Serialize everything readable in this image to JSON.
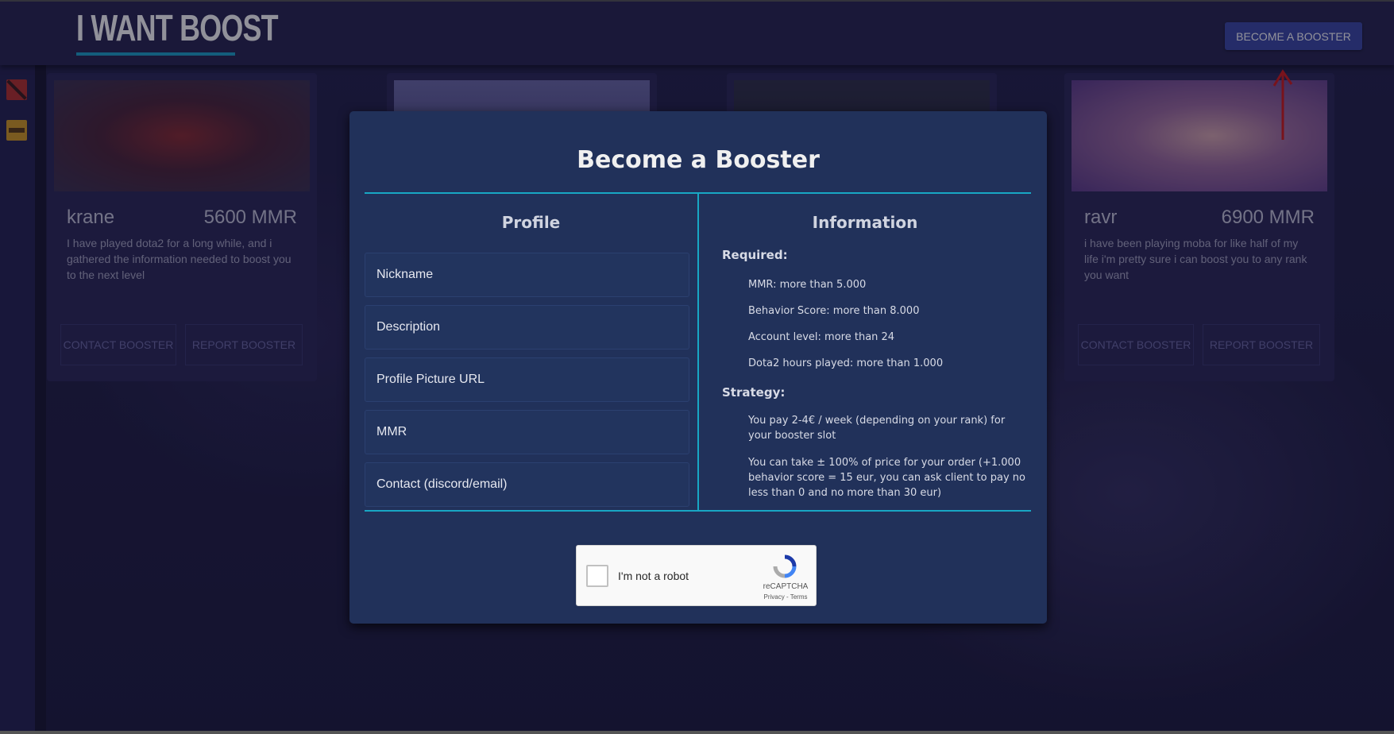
{
  "header": {
    "logo": "I WANT BOOST",
    "become_booster_label": "BECOME A BOOSTER"
  },
  "sidebar": {
    "items": [
      {
        "icon": "dota2-icon"
      },
      {
        "icon": "csgo-icon"
      }
    ]
  },
  "cards": [
    {
      "name": "krane",
      "mmr": "5600 MMR",
      "description": "I have played dota2 for a long while, and i gathered the information needed to boost you to the next level",
      "contact_label": "CONTACT BOOSTER",
      "report_label": "REPORT BOOSTER"
    },
    {
      "name": "ravr",
      "mmr": "6900 MMR",
      "description": "i have been playing moba for like half of my life i'm pretty sure i can boost you to any rank you want",
      "contact_label": "CONTACT BOOSTER",
      "report_label": "REPORT BOOSTER"
    }
  ],
  "modal": {
    "title": "Become a Booster",
    "profile": {
      "heading": "Profile",
      "fields": [
        {
          "placeholder": "Nickname"
        },
        {
          "placeholder": "Description"
        },
        {
          "placeholder": "Profile Picture URL"
        },
        {
          "placeholder": "MMR"
        },
        {
          "placeholder": "Contact (discord/email)"
        }
      ]
    },
    "information": {
      "heading": "Information",
      "required_heading": "Required:",
      "required": [
        "MMR: more than 5.000",
        "Behavior Score: more than 8.000",
        "Account level: more than 24",
        "Dota2 hours played: more than 1.000"
      ],
      "strategy_heading": "Strategy:",
      "strategy": [
        "You pay 2-4€ / week (depending on your rank) for your booster slot",
        "You can take ± 100% of price for your order (+1.000 behavior score = 15 eur, you can ask client to pay no less than 0 and no more than 30 eur)"
      ]
    },
    "captcha": {
      "label": "I'm not a robot",
      "brand": "reCAPTCHA",
      "links": "Privacy - Terms"
    }
  },
  "colors": {
    "accent": "#18a7c4",
    "button": "#3b48a6",
    "modal_bg": "#21315a",
    "annotation_arrow": "#d11a1a"
  }
}
